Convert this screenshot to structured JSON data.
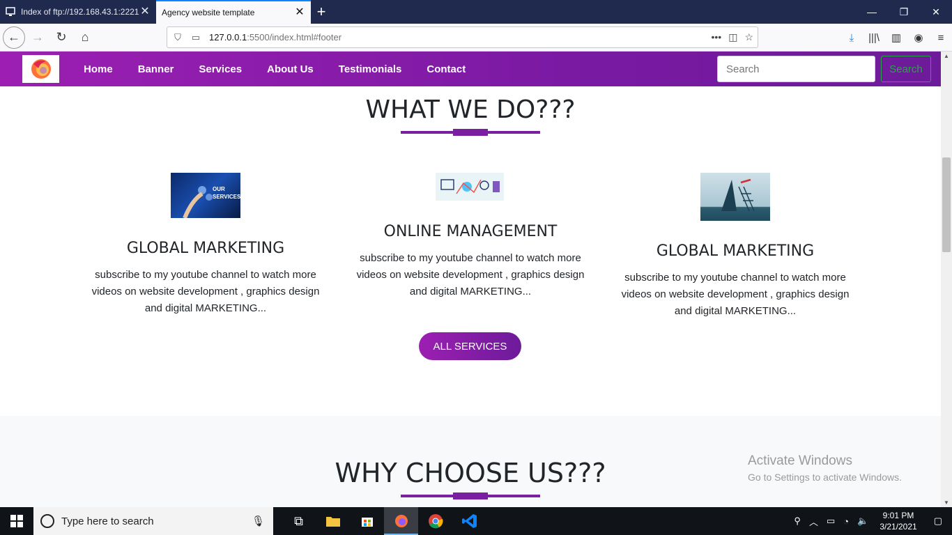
{
  "browser": {
    "tabs": [
      {
        "title": "Index of ftp://192.168.43.1:2221",
        "active": false
      },
      {
        "title": "Agency website template",
        "active": true
      }
    ],
    "url_host": "127.0.0.1",
    "url_path": ":5500/index.html#footer"
  },
  "site": {
    "menu": [
      "Home",
      "Banner",
      "Services",
      "About Us",
      "Testimonials",
      "Contact"
    ],
    "search_placeholder": "Search",
    "search_button": "Search"
  },
  "what_we_do": {
    "heading": "WHAT WE DO???",
    "cards": [
      {
        "title": "GLOBAL MARKETING",
        "text": "subscribe to my youtube channel to watch more videos on website development , graphics design and digital MARKETING...",
        "image_label": "OUR SERVICES"
      },
      {
        "title": "ONLINE MANAGEMENT",
        "text": "subscribe to my youtube channel to watch more videos on website development , graphics design and digital MARKETING..."
      },
      {
        "title": "GLOBAL MARKETING",
        "text": "subscribe to my youtube channel to watch more videos on website development , graphics design and digital MARKETING..."
      }
    ],
    "button": "ALL SERVICES"
  },
  "why_choose_us": {
    "heading": "WHY CHOOSE US???"
  },
  "watermark": {
    "line1": "Activate Windows",
    "line2": "Go to Settings to activate Windows."
  },
  "taskbar": {
    "search_placeholder": "Type here to search",
    "time": "9:01 PM",
    "date": "3/21/2021"
  },
  "colors": {
    "accent": "#7b1fa2",
    "nav_gradient_start": "#9c1fb2",
    "search_button": "#28a745"
  }
}
